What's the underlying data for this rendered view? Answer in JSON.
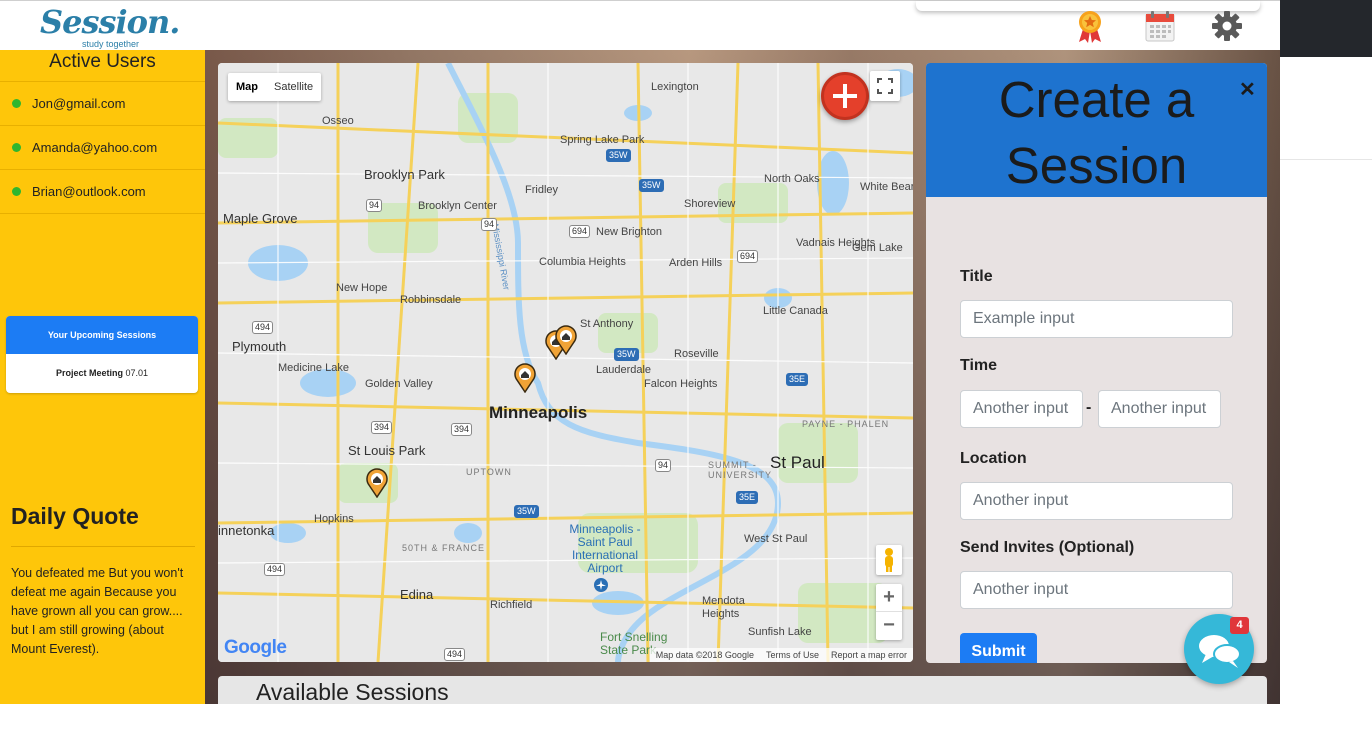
{
  "brand": {
    "name": "Session.",
    "tagline": "study together"
  },
  "header": {
    "icons": [
      "award-icon",
      "calendar-icon",
      "gear-icon"
    ]
  },
  "sidebar": {
    "title": "Active Users",
    "users": [
      {
        "email": "Jon@gmail.com",
        "status_color": "#2fb62f"
      },
      {
        "email": "Amanda@yahoo.com",
        "status_color": "#2fb62f"
      },
      {
        "email": "Brian@outlook.com",
        "status_color": "#2fb62f"
      }
    ],
    "upcoming": {
      "title": "Your Upcoming Sessions",
      "item_name": "Project Meeting",
      "item_date": "07.01"
    },
    "quote": {
      "title": "Daily Quote",
      "text": "You defeated me But you won't defeat me again Because you have grown all you can grow.... but I am still growing (about Mount Everest)."
    }
  },
  "map": {
    "type_options": [
      "Map",
      "Satellite"
    ],
    "selected_type": "Map",
    "google": "Google",
    "attribution": [
      "Map data ©2018 Google",
      "Terms of Use",
      "Report a map error"
    ],
    "labels": {
      "minneapolis": "Minneapolis",
      "st_paul": "St Paul",
      "brooklyn_park": "Brooklyn Park",
      "maple_grove": "Maple Grove",
      "brooklyn_center": "Brooklyn Center",
      "fridley": "Fridley",
      "spring_lake_park": "Spring Lake Park",
      "lexington": "Lexington",
      "north_oaks": "North Oaks",
      "shoreview": "Shoreview",
      "new_brighton": "New Brighton",
      "columbia_heights": "Columbia Heights",
      "arden_hills": "Arden Hills",
      "vadnais_heights": "Vadnais Heights",
      "gem_lake": "Gem Lake",
      "new_hope": "New Hope",
      "robbinsdale": "Robbinsdale",
      "plymouth": "Plymouth",
      "medicine_lake": "Medicine Lake",
      "golden_valley": "Golden Valley",
      "st_anthony": "St Anthony",
      "lauderdale": "Lauderdale",
      "roseville": "Roseville",
      "falcon_heights": "Falcon Heights",
      "little_canada": "Little Canada",
      "st_louis_park": "St Louis Park",
      "hopkins": "Hopkins",
      "minnetonka": "innetonka",
      "edina": "Edina",
      "richfield": "Richfield",
      "west_st_paul": "West St Paul",
      "mendota_heights": "Mendota Heights",
      "sunfish_lake": "Sunfish Lake",
      "fort_snelling": "Fort Snelling State Park",
      "airport": "Minneapolis -Saint Paul International Airport",
      "osseo": "Osseo",
      "uptown": "UPTOWN",
      "fifty_france": "50TH & FRANCE",
      "payne_phalen": "PAYNE - PHALEN",
      "summit_university": "SUMMIT - UNIVERSITY",
      "mississippi_river": "Mississippi River",
      "north_bear": "White Bear"
    },
    "markers": 4
  },
  "create": {
    "title": "Create a Session",
    "title_line1": "Create a",
    "title_line2": "Session",
    "fields": {
      "title_label": "Title",
      "title_placeholder": "Example input",
      "time_label": "Time",
      "time_start_placeholder": "Another input",
      "time_end_placeholder": "Another input",
      "time_separator": "-",
      "location_label": "Location",
      "location_placeholder": "Another input",
      "invites_label": "Send Invites (Optional)",
      "invites_placeholder": "Another input"
    },
    "submit_label": "Submit"
  },
  "available": {
    "title": "Available Sessions"
  },
  "chat": {
    "badge": "4"
  },
  "colors": {
    "sidebar": "#fec60a",
    "accent": "#1c7cf4",
    "panel_head": "#1e73cf",
    "add_button": "#e4402b"
  }
}
